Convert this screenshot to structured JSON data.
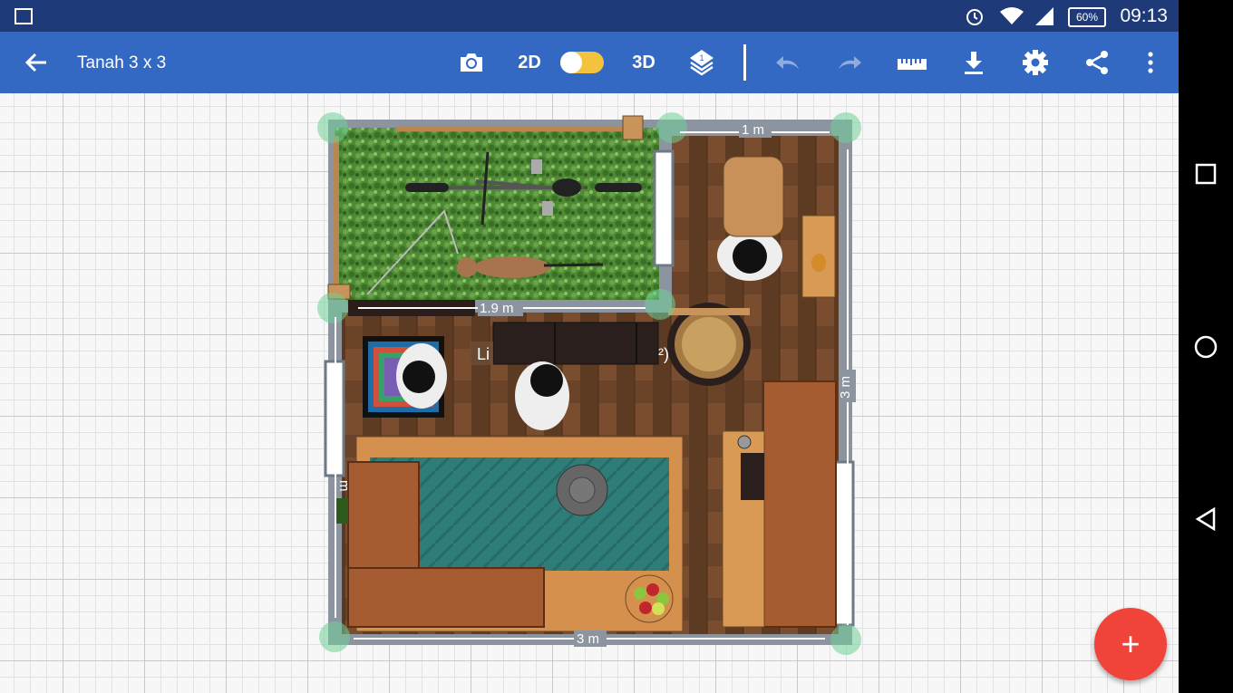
{
  "statusbar": {
    "time": "09:13",
    "battery": "60%"
  },
  "toolbar": {
    "title": "Tanah 3 x 3",
    "mode_2d": "2D",
    "mode_3d": "3D",
    "layer_number": "1"
  },
  "plan": {
    "dim_top": "1 m",
    "dim_mid": "1.9 m",
    "dim_right": "3 m",
    "dim_bottom": "3 m",
    "dim_left": "m",
    "room_label": "Li",
    "room_label_suffix": "²)"
  },
  "fab": {
    "label": "+"
  },
  "colors": {
    "toolbar": "#3369c2",
    "statusbar": "#1f3a78",
    "fab": "#f0433a",
    "toggle": "#f3c33d"
  }
}
